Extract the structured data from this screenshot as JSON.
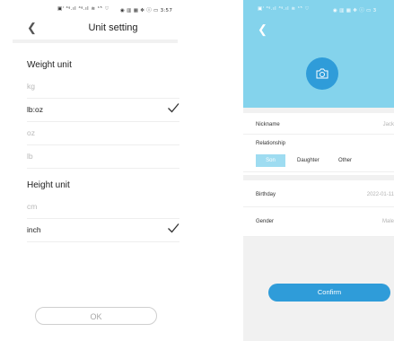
{
  "left_screen": {
    "status": {
      "left": "▣ᴵ ⁴ᵍ.ıl ⁴ᵍ.ıl ≋ ¹⁵ ♡",
      "right": "◉ ▥ ▦ ✻ ⓘ ▭ 3:57"
    },
    "title": "Unit setting",
    "weight_section": "Weight unit",
    "weight_units": [
      {
        "label": "kg",
        "selected": false
      },
      {
        "label": "lb:oz",
        "selected": true
      },
      {
        "label": "oz",
        "selected": false
      },
      {
        "label": "lb",
        "selected": false
      }
    ],
    "height_section": "Height unit",
    "height_units": [
      {
        "label": "cm",
        "selected": false
      },
      {
        "label": "inch",
        "selected": true
      }
    ],
    "ok_label": "OK"
  },
  "right_screen": {
    "status": {
      "left": "▣ᴵ ⁴ᵍ.ıl ⁴ᵍ.ıl ≋ ¹⁵ ♡",
      "right": "◉ ▥ ▦ ✻ ⓘ ▭ 3"
    },
    "hero_color": "#84d3ec",
    "accent_color": "#2f9cd9",
    "avatar_icon": "camera-icon",
    "nickname_label": "Nickname",
    "nickname_value": "Jack",
    "relationship_label": "Relationship",
    "relationship_options": [
      "Son",
      "Daughter",
      "Other"
    ],
    "relationship_selected": "Son",
    "birthday_label": "Birthday",
    "birthday_value": "2022-01-11",
    "gender_label": "Gender",
    "gender_value": "Male",
    "confirm_label": "Confirm"
  }
}
